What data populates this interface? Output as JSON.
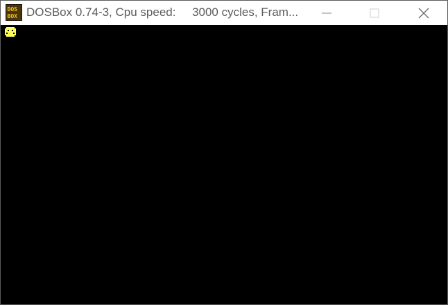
{
  "window": {
    "title": "DOSBox 0.74-3, Cpu speed:     3000 cycles, Fram...",
    "app_icon": "dosbox-icon",
    "controls": {
      "minimize_icon": "minimize-icon",
      "maximize_icon": "maximize-icon",
      "close_icon": "close-icon"
    }
  },
  "screen": {
    "background": "#000000",
    "glyph": "smiley-face-icon",
    "glyph_color": "#ffff55"
  }
}
